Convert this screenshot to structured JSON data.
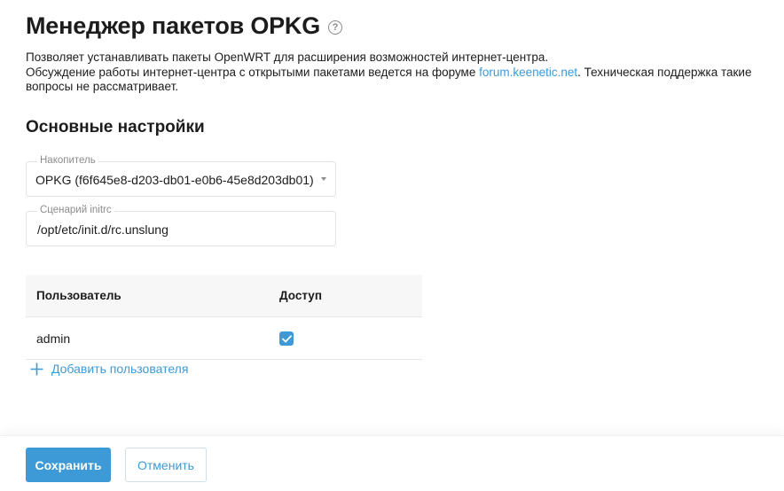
{
  "header": {
    "title": "Менеджер пакетов OPKG",
    "help_icon": "question-circle-icon"
  },
  "description": {
    "line1": "Позволяет устанавливать пакеты OpenWRT для расширения возможностей интернет-центра.",
    "line2_before": "Обсуждение работы интернет-центра с открытыми пакетами ведется на форуме ",
    "forum_link": "forum.keenetic.net",
    "line2_after": ". Техническая поддержка такие вопросы не рассматривает."
  },
  "settings": {
    "title": "Основные настройки",
    "storage": {
      "label": "Накопитель",
      "value": "OPKG (f6f645e8-d203-db01-e0b6-45e8d203db01)"
    },
    "initrc": {
      "label": "Сценарий initrc",
      "value": "/opt/etc/init.d/rc.unslung"
    }
  },
  "users_table": {
    "columns": [
      "Пользователь",
      "Доступ"
    ],
    "rows": [
      {
        "user": "admin",
        "access": true
      }
    ],
    "add_label": "Добавить пользователя"
  },
  "footer": {
    "save_label": "Сохранить",
    "cancel_label": "Отменить"
  },
  "colors": {
    "accent": "#3d9ad6",
    "text": "#1c1c1c",
    "muted": "#8c8c8c"
  }
}
